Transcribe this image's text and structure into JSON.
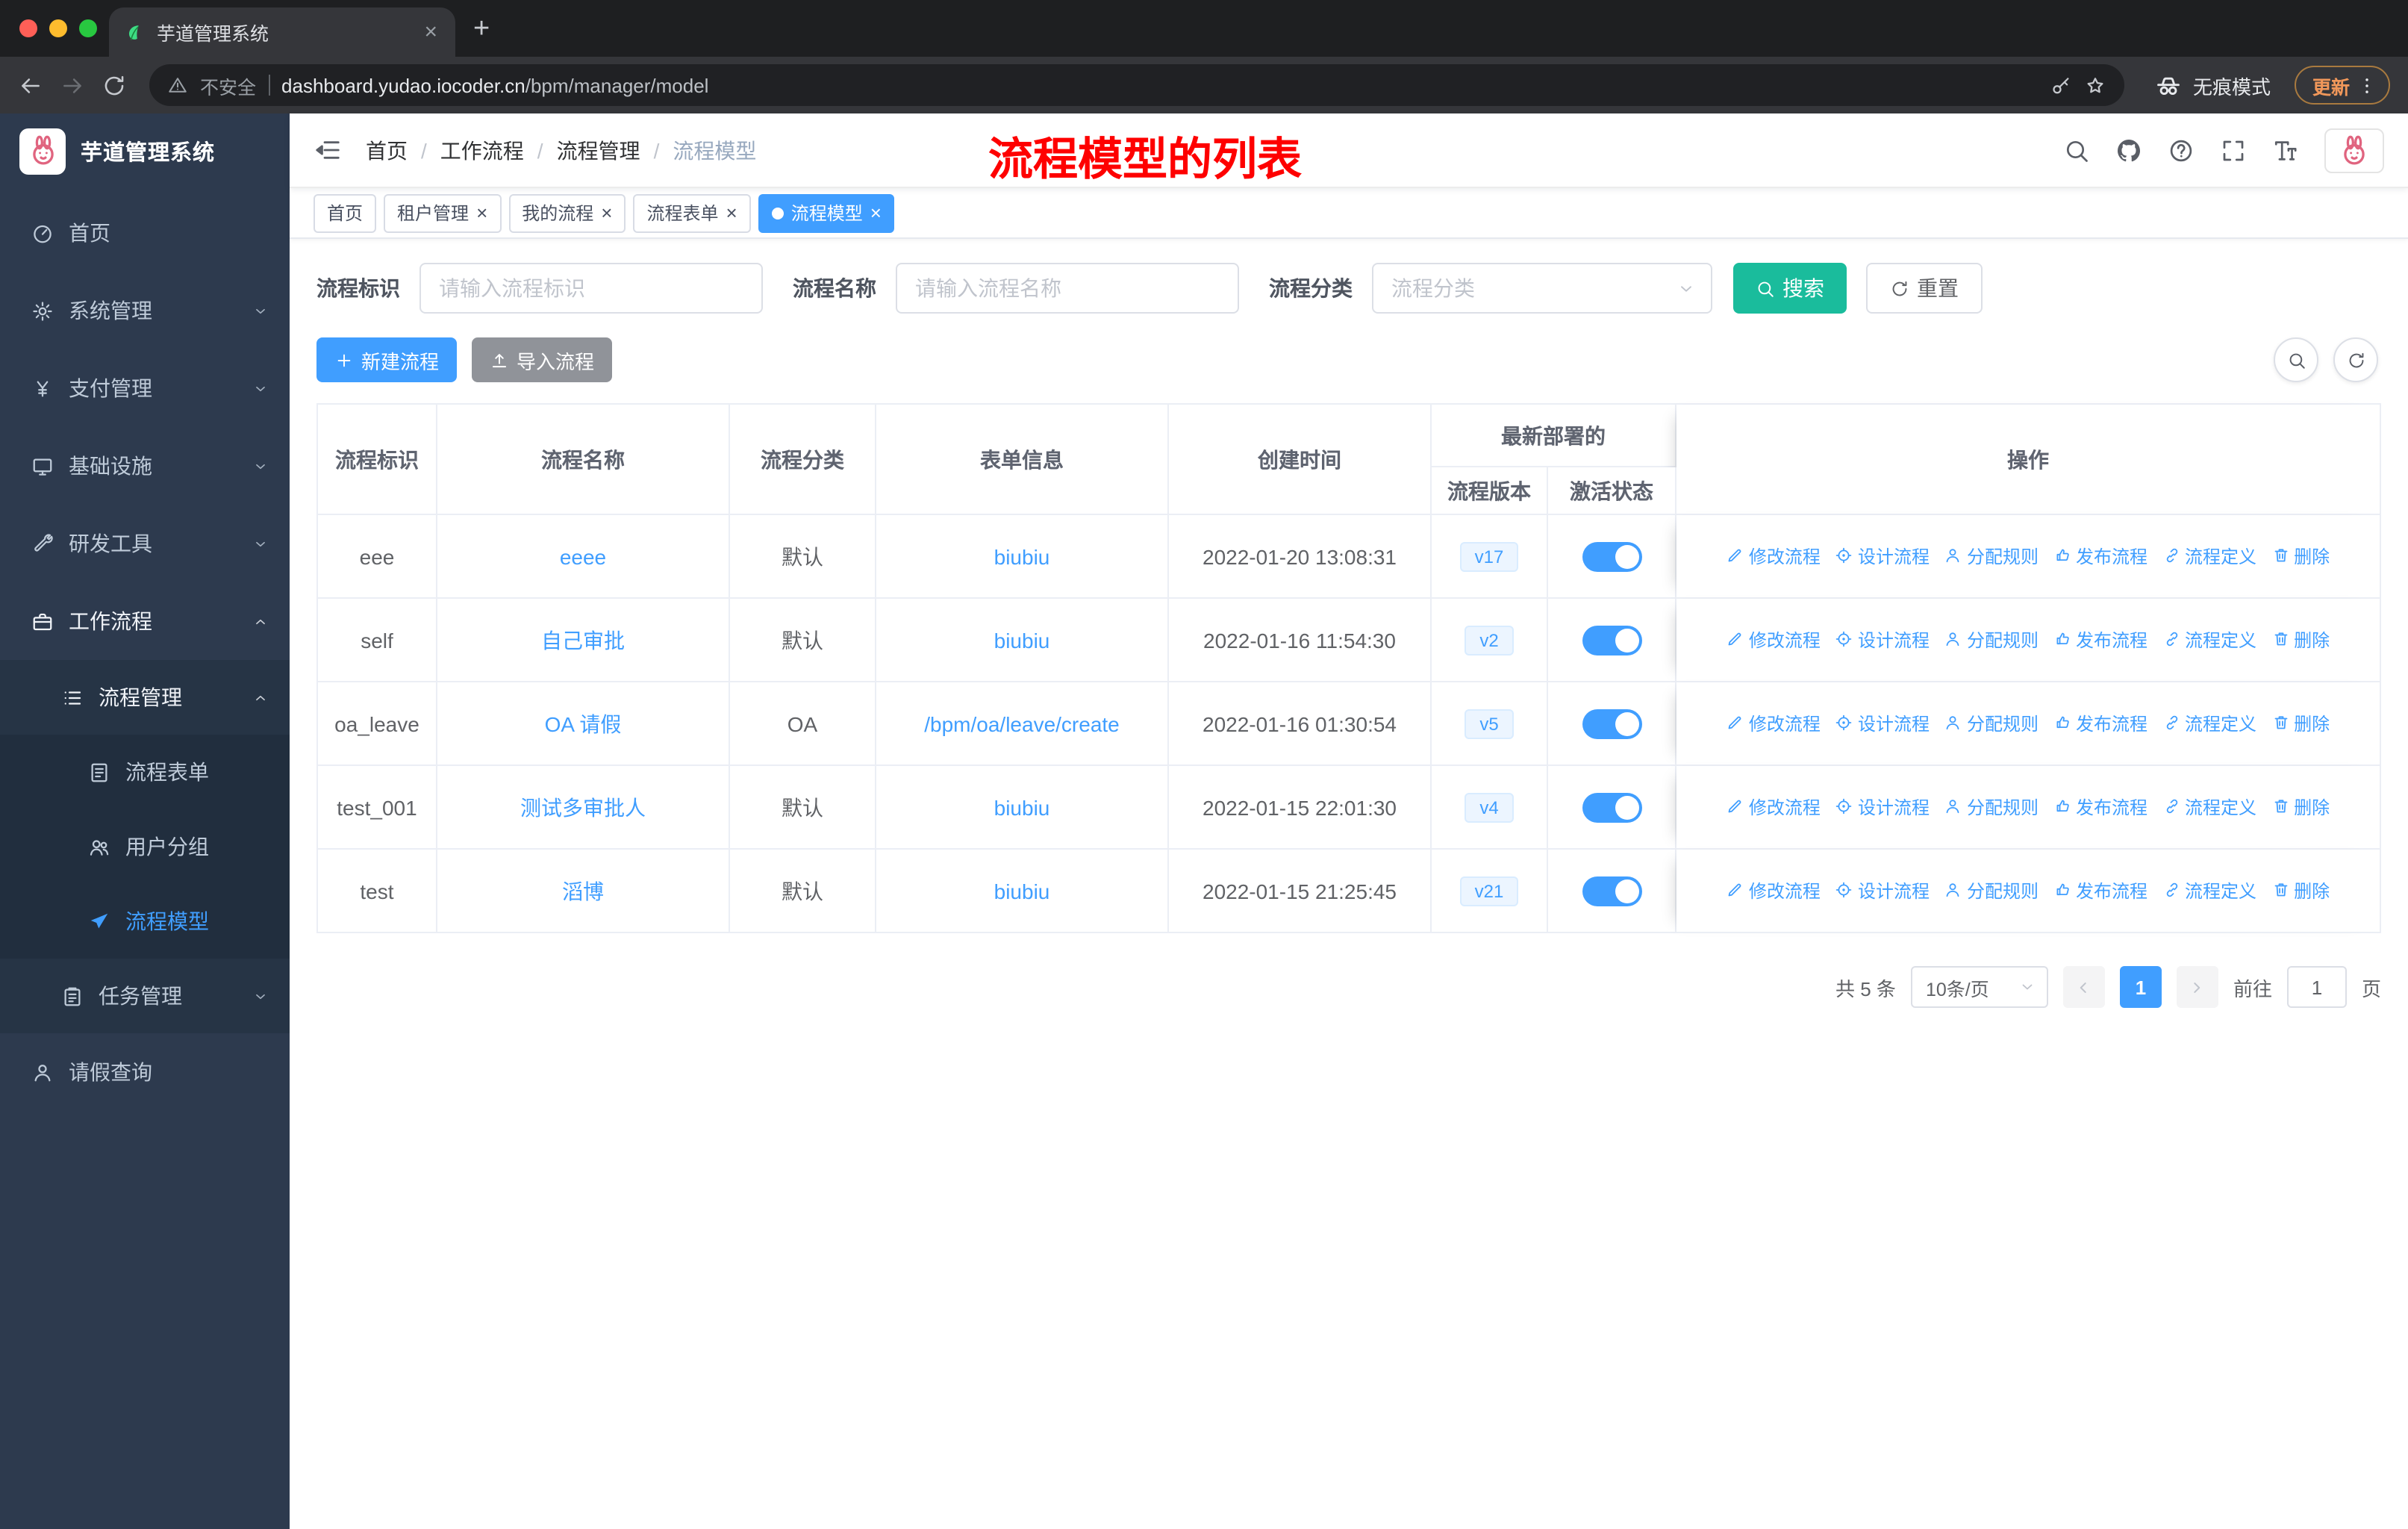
{
  "browser": {
    "tab": {
      "title": "芋道管理系统"
    },
    "address": {
      "security_text": "不安全",
      "domain": "dashboard.yudao.iocoder.cn",
      "path": "/bpm/manager/model"
    },
    "incognito_label": "无痕模式",
    "update_label": "更新"
  },
  "sidebar": {
    "logo_text": "芋道管理系统",
    "menu": [
      {
        "id": "home",
        "label": "首页",
        "icon": "home-icon"
      },
      {
        "id": "system-management",
        "label": "系统管理",
        "icon": "gear-icon",
        "state": "collapsed"
      },
      {
        "id": "payment-management",
        "label": "支付管理",
        "icon": "yen-icon",
        "state": "collapsed"
      },
      {
        "id": "infrastructure",
        "label": "基础设施",
        "icon": "monitor-icon",
        "state": "collapsed"
      },
      {
        "id": "dev-tools",
        "label": "研发工具",
        "icon": "tool-icon",
        "state": "collapsed"
      },
      {
        "id": "workflow",
        "label": "工作流程",
        "icon": "briefcase-icon",
        "state": "expanded",
        "children": [
          {
            "id": "process-management",
            "label": "流程管理",
            "icon": "list-icon",
            "state": "expanded",
            "children": [
              {
                "id": "process-form",
                "label": "流程表单",
                "icon": "form-icon"
              },
              {
                "id": "user-group",
                "label": "用户分组",
                "icon": "users-icon"
              },
              {
                "id": "process-model",
                "label": "流程模型",
                "icon": "send-icon",
                "active": true
              }
            ]
          },
          {
            "id": "task-management",
            "label": "任务管理",
            "icon": "task-icon",
            "state": "collapsed"
          }
        ]
      },
      {
        "id": "leave-query",
        "label": "请假查询",
        "icon": "person-icon"
      }
    ]
  },
  "header": {
    "breadcrumb": [
      "首页",
      "工作流程",
      "流程管理",
      "流程模型"
    ],
    "annotation": "流程模型的列表"
  },
  "tags": [
    {
      "label": "首页",
      "closable": false,
      "active": false
    },
    {
      "label": "租户管理",
      "closable": true,
      "active": false
    },
    {
      "label": "我的流程",
      "closable": true,
      "active": false
    },
    {
      "label": "流程表单",
      "closable": true,
      "active": false
    },
    {
      "label": "流程模型",
      "closable": true,
      "active": true
    }
  ],
  "filters": {
    "fields": [
      {
        "label": "流程标识",
        "placeholder": "请输入流程标识",
        "type": "input"
      },
      {
        "label": "流程名称",
        "placeholder": "请输入流程名称",
        "type": "input"
      },
      {
        "label": "流程分类",
        "placeholder": "流程分类",
        "type": "select"
      }
    ],
    "search_label": "搜索",
    "reset_label": "重置"
  },
  "toolbar": {
    "create_label": "新建流程",
    "import_label": "导入流程"
  },
  "table": {
    "columns": [
      "流程标识",
      "流程名称",
      "流程分类",
      "表单信息",
      "创建时间"
    ],
    "group_header": "最新部署的",
    "sub_columns": [
      "流程版本",
      "激活状态"
    ],
    "ops_header": "操作",
    "actions": [
      {
        "id": "modify",
        "label": "修改流程",
        "icon": "edit-icon"
      },
      {
        "id": "design",
        "label": "设计流程",
        "icon": "design-icon"
      },
      {
        "id": "assign-rule",
        "label": "分配规则",
        "icon": "user-icon"
      },
      {
        "id": "publish",
        "label": "发布流程",
        "icon": "publish-icon"
      },
      {
        "id": "definition",
        "label": "流程定义",
        "icon": "definition-icon"
      },
      {
        "id": "delete",
        "label": "删除",
        "icon": "delete-icon"
      }
    ],
    "rows": [
      {
        "key": "eee",
        "name": "eeee",
        "category": "默认",
        "form": "biubiu",
        "created": "2022-01-20 13:08:31",
        "version": "v17",
        "active": true
      },
      {
        "key": "self",
        "name": "自己审批",
        "category": "默认",
        "form": "biubiu",
        "created": "2022-01-16 11:54:30",
        "version": "v2",
        "active": true
      },
      {
        "key": "oa_leave",
        "name": "OA 请假",
        "category": "OA",
        "form": "/bpm/oa/leave/create",
        "created": "2022-01-16 01:30:54",
        "version": "v5",
        "active": true
      },
      {
        "key": "test_001",
        "name": "测试多审批人",
        "category": "默认",
        "form": "biubiu",
        "created": "2022-01-15 22:01:30",
        "version": "v4",
        "active": true
      },
      {
        "key": "test",
        "name": "滔博",
        "category": "默认",
        "form": "biubiu",
        "created": "2022-01-15 21:25:45",
        "version": "v21",
        "active": true
      }
    ]
  },
  "pagination": {
    "total_text": "共 5 条",
    "page_size": "10条/页",
    "current_page": "1",
    "goto_label": "前往",
    "goto_value": "1",
    "page_label": "页"
  },
  "colors": {
    "primary": "#409eff",
    "search_button": "#1abc9c",
    "annotation": "#ff0000",
    "sidebar_bg": "#2d3a4e",
    "link": "#409eff",
    "toggle_on": "#409eff",
    "tag_active_bg": "#409eff"
  }
}
